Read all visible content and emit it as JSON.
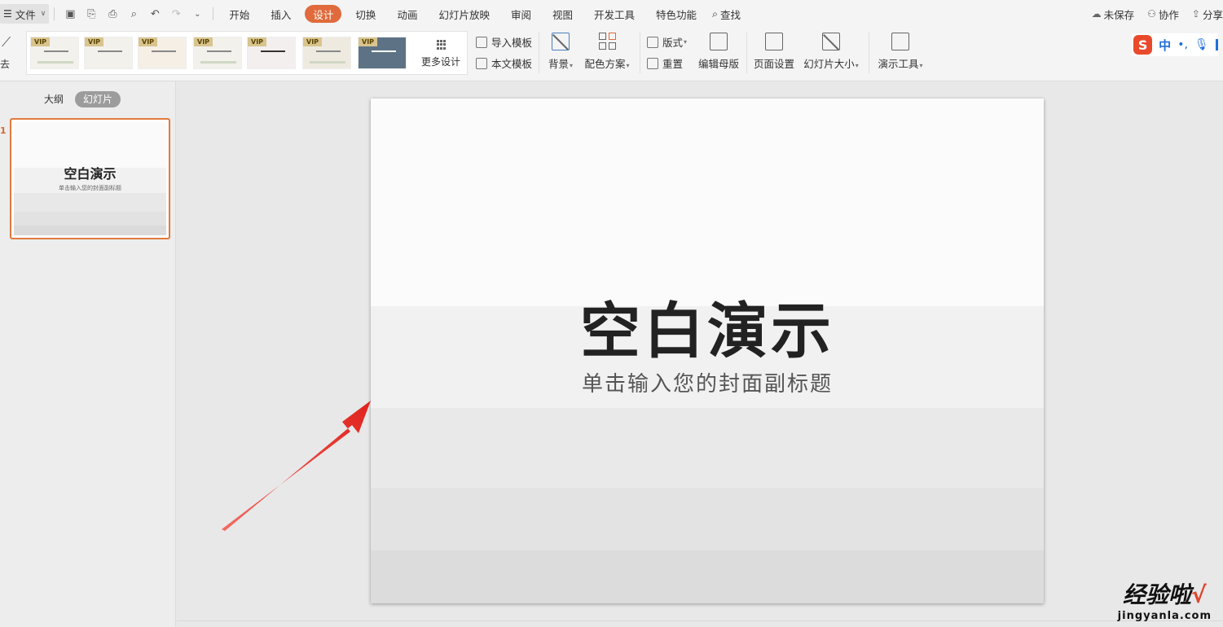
{
  "menubar": {
    "file_label": "文件",
    "tabs": [
      {
        "label": "开始",
        "active": false
      },
      {
        "label": "插入",
        "active": false
      },
      {
        "label": "设计",
        "active": true
      },
      {
        "label": "切换",
        "active": false
      },
      {
        "label": "动画",
        "active": false
      },
      {
        "label": "幻灯片放映",
        "active": false
      },
      {
        "label": "审阅",
        "active": false
      },
      {
        "label": "视图",
        "active": false
      },
      {
        "label": "开发工具",
        "active": false
      },
      {
        "label": "特色功能",
        "active": false
      }
    ],
    "search_label": "查找",
    "right": {
      "unsaved": "未保存",
      "collab": "协作",
      "share": "分享"
    }
  },
  "ribbon": {
    "left_cut_label": "去",
    "template_badge": "VIP",
    "more_design": "更多设计",
    "import_template": "导入模板",
    "text_template": "本文模板",
    "background": "背景",
    "color_scheme": "配色方案",
    "layout": "版式",
    "reset": "重置",
    "edit_master": "编辑母版",
    "page_setup": "页面设置",
    "slide_size": "幻灯片大小",
    "presentation_tools": "演示工具"
  },
  "ime": {
    "logo": "S",
    "lang": "中"
  },
  "leftpanel": {
    "tab_outline": "大纲",
    "tab_slides": "幻灯片",
    "slide_number": "1",
    "thumb_title": "空白演示",
    "thumb_subtitle": "单击输入您的封面副标题"
  },
  "slide": {
    "title": "空白演示",
    "subtitle": "单击输入您的封面副标题"
  },
  "watermark": {
    "main": "经验啦",
    "check": "√",
    "sub": "jingyanla.com"
  },
  "colors": {
    "accent": "#e06a3b",
    "arrow": "#e8302a"
  }
}
